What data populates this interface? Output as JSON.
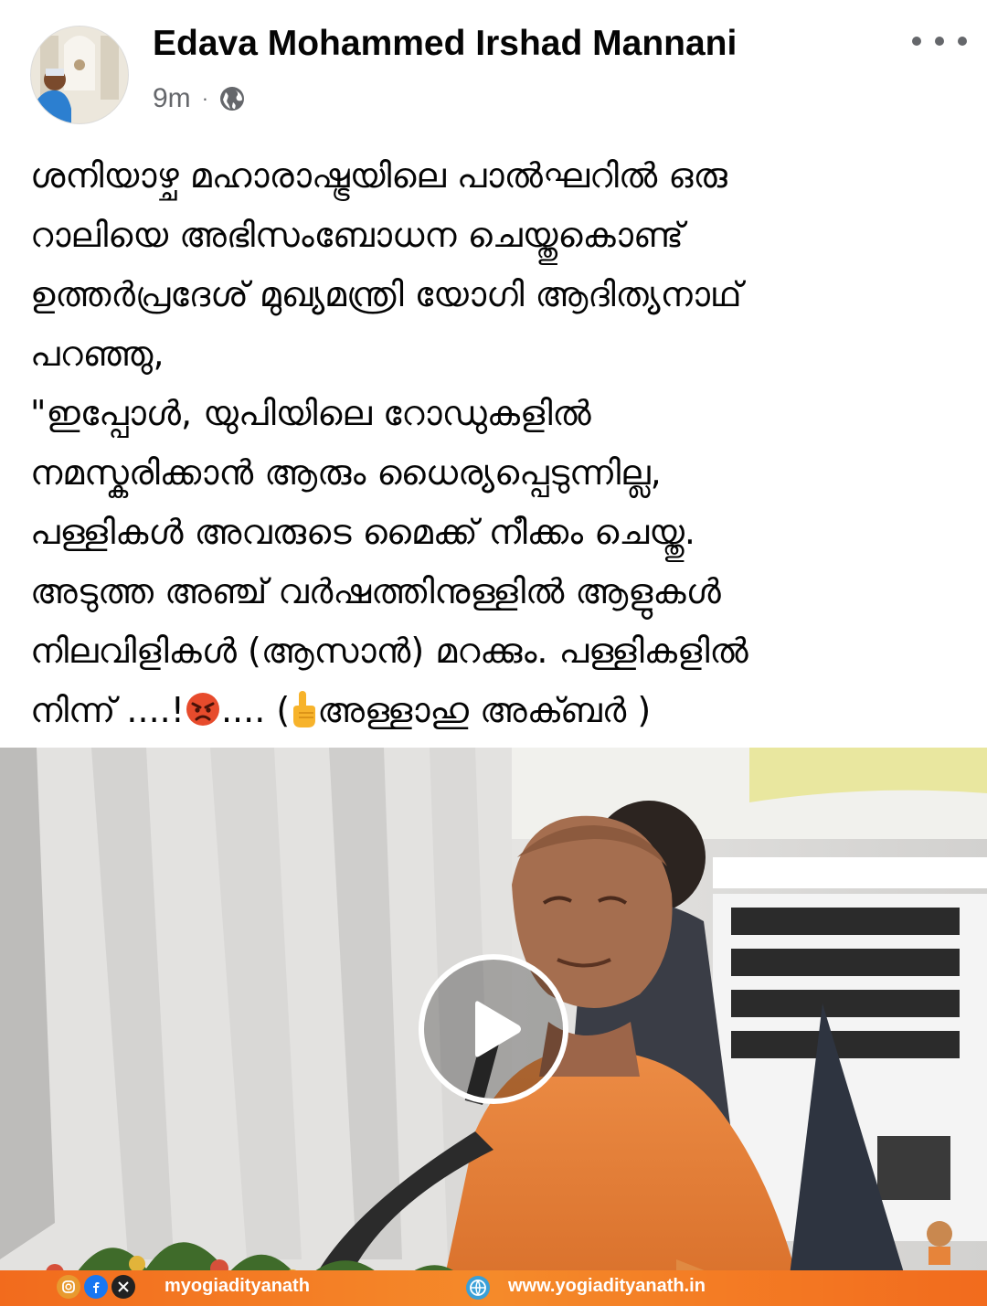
{
  "post": {
    "author_name": "Edava Mohammed Irshad Mannani",
    "timestamp": "9m",
    "separator": "·",
    "audience_icon": "globe-icon",
    "more_icon": "more-options-icon",
    "text_lines": [
      "ശനിയാഴ്ച മഹാരാഷ്ട്രയിലെ പാൽഘറിൽ ഒരു",
      "റാലിയെ അഭിസംബോധന ചെയ്തുകൊണ്ട്",
      "ഉത്തർപ്രദേശ് മുഖ്യമന്ത്രി യോഗി ആദിത്യനാഥ്",
      "പറഞ്ഞു,",
      "\"ഇപ്പോൾ, യുപിയിലെ റോഡുകളിൽ",
      "നമസ്കരിക്കാൻ ആരും ധൈര്യപ്പെടുന്നില്ല,",
      "പള്ളികൾ അവരുടെ മൈക്ക് നീക്കം ചെയ്തു.",
      "അടുത്ത അഞ്ച് വർഷത്തിനുള്ളിൽ ആളുകൾ",
      "നിലവിളികൾ (ആസാൻ) മറക്കും. പള്ളികളിൽ"
    ],
    "last_line": {
      "part1": "നിന്ന് ....!",
      "emoji1": "angry-face-emoji",
      "part2": ".... (",
      "emoji2": "pointing-up-hand-emoji",
      "part3": "അള്ളാഹു അക്ബർ )"
    }
  },
  "video": {
    "play_icon": "play-icon",
    "footer": {
      "social_icons": [
        "instagram-icon",
        "facebook-icon",
        "x-icon"
      ],
      "handle": "myogiadityanath",
      "website_icon": "web-icon",
      "website": "www.yogiadityanath.in"
    }
  },
  "colors": {
    "text_primary": "#050505",
    "text_secondary": "#65676b",
    "footer_orange": "#f26b1d",
    "robe_saffron": "#e8803a"
  }
}
